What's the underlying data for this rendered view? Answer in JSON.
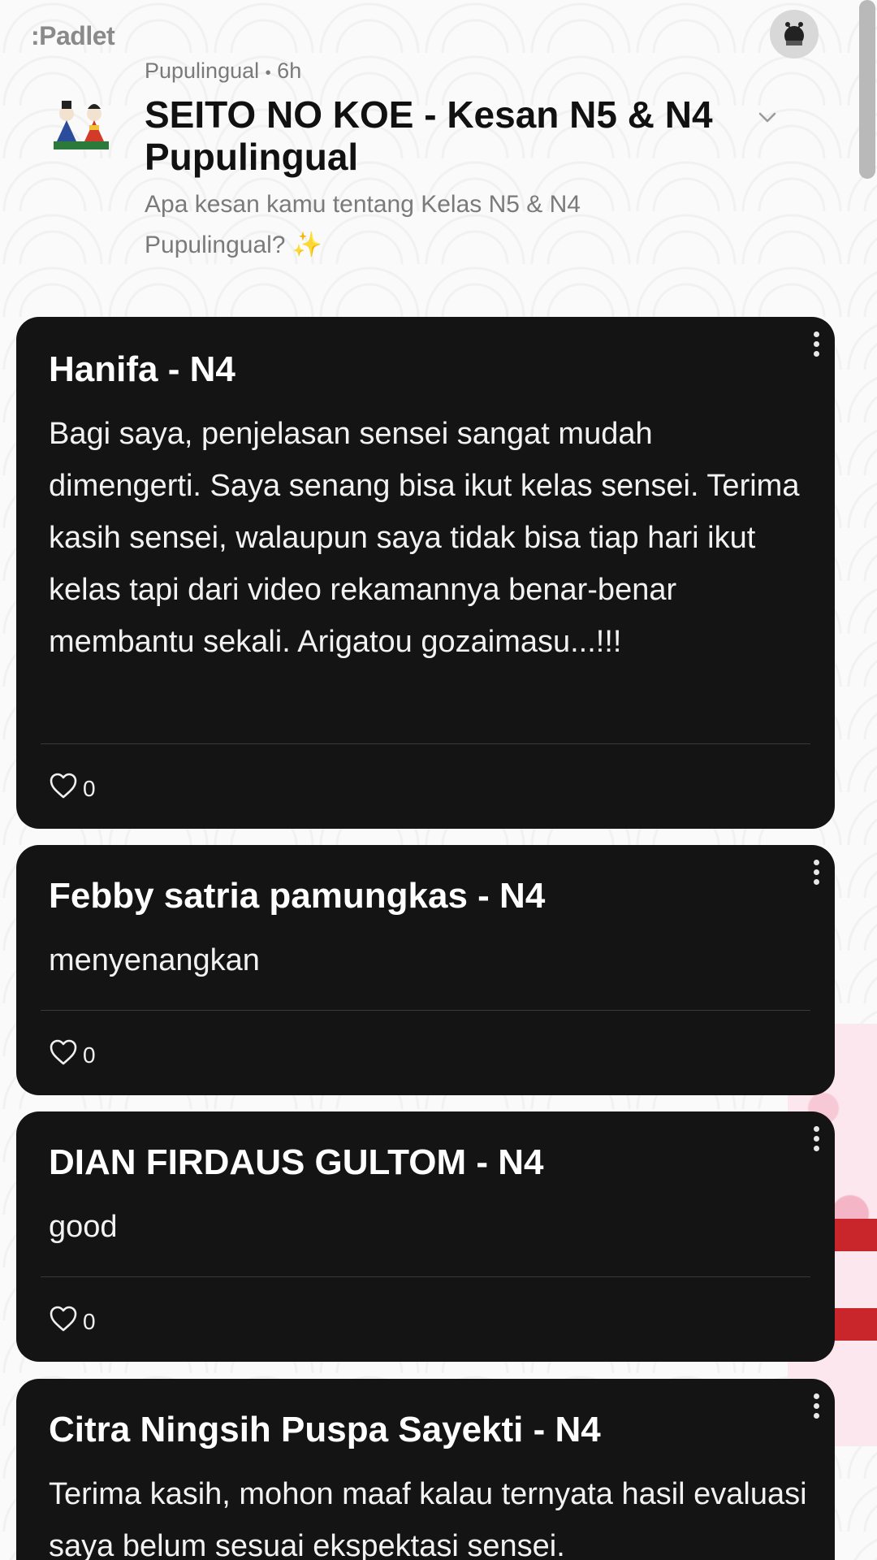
{
  "app": {
    "logo": ":Padlet"
  },
  "board": {
    "author": "Pupulingual",
    "time": "6h",
    "meta_separator": "•",
    "title": "SEITO NO KOE - Kesan N5 & N4 Pupulingual",
    "description": "Apa kesan kamu tentang Kelas N5 & N4 Pupulingual? ✨"
  },
  "posts": [
    {
      "title": "Hanifa - N4",
      "body": "Bagi saya, penjelasan sensei sangat mudah dimengerti. Saya senang bisa ikut kelas sensei. Terima kasih sensei, walaupun saya tidak bisa tiap hari ikut kelas tapi dari video rekamannya benar-benar membantu sekali. Arigatou gozaimasu...!!!",
      "likes": "0"
    },
    {
      "title": "Febby satria pamungkas - N4",
      "body": "menyenangkan",
      "likes": "0"
    },
    {
      "title": "DIAN FIRDAUS GULTOM - N4",
      "body": "good",
      "likes": "0"
    },
    {
      "title": "Citra Ningsih Puspa Sayekti - N4",
      "body": "Terima kasih, mohon maaf kalau ternyata hasil evaluasi saya belum sesuai ekspektasi sensei.",
      "likes": ""
    }
  ],
  "icons": {
    "avatar": "user-avatar-icon",
    "board": "hina-dolls-icon",
    "chevron": "chevron-down-icon",
    "more": "more-vertical-icon",
    "like": "heart-icon"
  },
  "colors": {
    "card_bg": "#141414",
    "card_text": "#ffffff",
    "muted_text": "#7a7a7a",
    "title_text": "#111111"
  }
}
